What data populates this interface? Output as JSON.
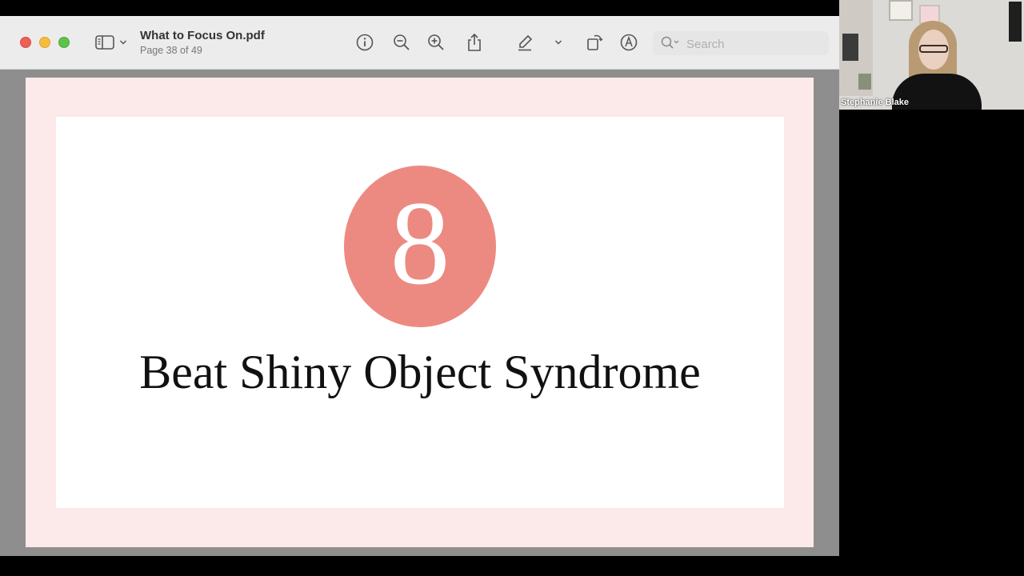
{
  "window": {
    "doc_title": "What to Focus On.pdf",
    "page_indicator": "Page 38 of 49"
  },
  "toolbar": {
    "search_placeholder": "Search",
    "icons": [
      "sidebar-icon",
      "chevron-down-icon",
      "info-icon",
      "zoom-out-icon",
      "zoom-in-icon",
      "share-icon",
      "highlight-pen-icon",
      "chevron-down-icon",
      "rotate-icon",
      "markup-icon",
      "search-icon"
    ]
  },
  "slide": {
    "number": "8",
    "title": "Beat Shiny Object Syndrome",
    "badge_color": "#ec8a82",
    "page_background": "#fbeae9"
  },
  "participant": {
    "name": "Stephanie Blake"
  }
}
